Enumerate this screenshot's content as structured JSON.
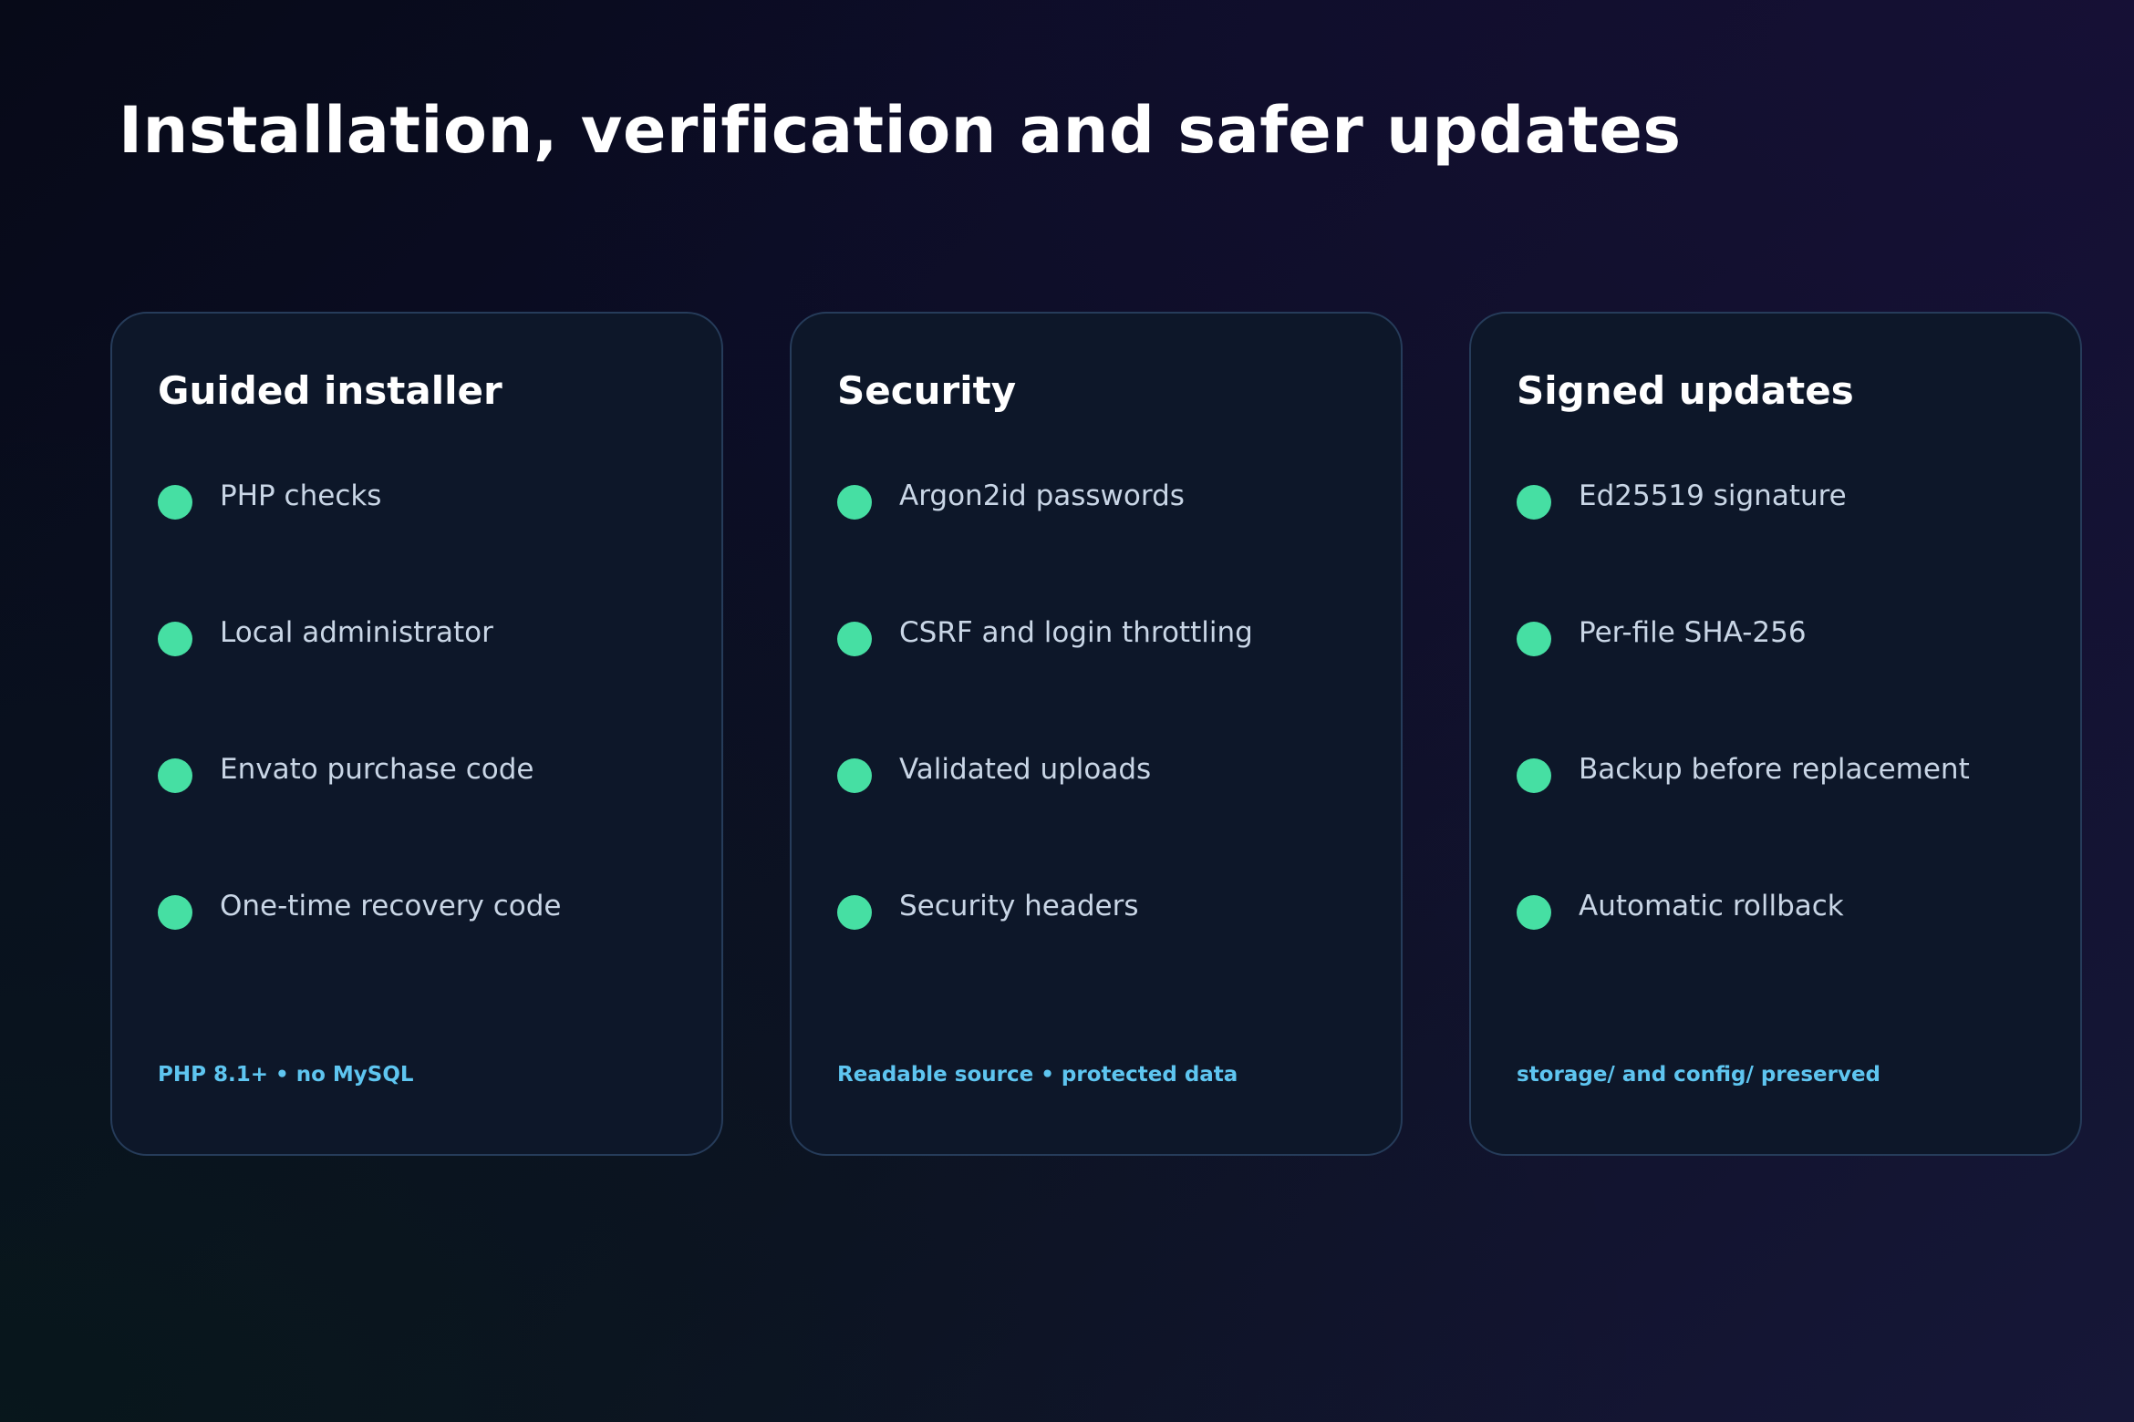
{
  "page": {
    "title": "Installation, verification and safer updates"
  },
  "colors": {
    "bullet": "#46dfa3",
    "footer_accent": "#5ec5f0",
    "card_border": "#263c5a",
    "card_background": "#0d1729"
  },
  "cards": [
    {
      "title": "Guided installer",
      "items": [
        {
          "label": "PHP checks"
        },
        {
          "label": "Local administrator"
        },
        {
          "label": "Envato purchase code"
        },
        {
          "label": "One-time recovery code"
        }
      ],
      "footer": "PHP 8.1+ • no MySQL"
    },
    {
      "title": "Security",
      "items": [
        {
          "label": "Argon2id passwords"
        },
        {
          "label": "CSRF and login throttling"
        },
        {
          "label": "Validated uploads"
        },
        {
          "label": "Security headers"
        }
      ],
      "footer": "Readable source • protected data"
    },
    {
      "title": "Signed updates",
      "items": [
        {
          "label": "Ed25519 signature"
        },
        {
          "label": "Per-file SHA-256"
        },
        {
          "label": "Backup before replacement"
        },
        {
          "label": "Automatic rollback"
        }
      ],
      "footer": "storage/ and config/ preserved"
    }
  ]
}
